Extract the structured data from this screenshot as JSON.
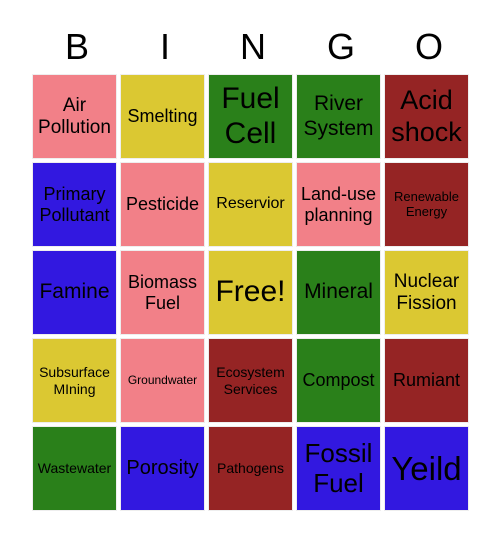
{
  "header": [
    "B",
    "I",
    "N",
    "G",
    "O"
  ],
  "colors": {
    "pink": "#f28088",
    "yellow": "#dbc832",
    "green": "#2a801a",
    "blue": "#3218e0",
    "red": "#952424"
  },
  "cells": [
    {
      "text": "Air Pollution",
      "color": "pink",
      "size": 19
    },
    {
      "text": "Smelting",
      "color": "yellow",
      "size": 18
    },
    {
      "text": "Fuel Cell",
      "color": "green",
      "size": 30
    },
    {
      "text": "River System",
      "color": "green",
      "size": 21
    },
    {
      "text": "Acid shock",
      "color": "red",
      "size": 27
    },
    {
      "text": "Primary Pollutant",
      "color": "blue",
      "size": 18
    },
    {
      "text": "Pesticide",
      "color": "pink",
      "size": 18
    },
    {
      "text": "Reservior",
      "color": "yellow",
      "size": 16
    },
    {
      "text": "Land-use planning",
      "color": "pink",
      "size": 18
    },
    {
      "text": "Renewable Energy",
      "color": "red",
      "size": 13
    },
    {
      "text": "Famine",
      "color": "blue",
      "size": 21
    },
    {
      "text": "Biomass Fuel",
      "color": "pink",
      "size": 18
    },
    {
      "text": "Free!",
      "color": "yellow",
      "size": 30
    },
    {
      "text": "Mineral",
      "color": "green",
      "size": 21
    },
    {
      "text": "Nuclear Fission",
      "color": "yellow",
      "size": 19
    },
    {
      "text": "Subsurface MIning",
      "color": "yellow",
      "size": 14
    },
    {
      "text": "Groundwater",
      "color": "pink",
      "size": 12
    },
    {
      "text": "Ecosystem Services",
      "color": "red",
      "size": 14
    },
    {
      "text": "Compost",
      "color": "green",
      "size": 18
    },
    {
      "text": "Rumiant",
      "color": "red",
      "size": 18
    },
    {
      "text": "Wastewater",
      "color": "green",
      "size": 14
    },
    {
      "text": "Porosity",
      "color": "blue",
      "size": 20
    },
    {
      "text": "Pathogens",
      "color": "red",
      "size": 14
    },
    {
      "text": "Fossil Fuel",
      "color": "blue",
      "size": 26
    },
    {
      "text": "Yeild",
      "color": "blue",
      "size": 33
    }
  ]
}
